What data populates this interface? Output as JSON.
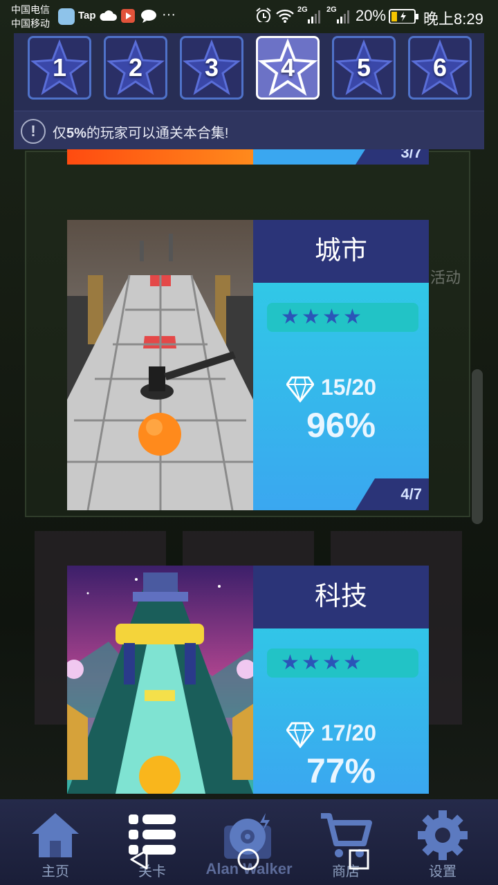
{
  "status_bar": {
    "carrier_1": "中国电信",
    "carrier_2": "中国移动",
    "tap_label": "Tap",
    "dots": "···",
    "signal_1": "2G",
    "signal_2": "2G",
    "battery": "20%",
    "time": "晚上8:29"
  },
  "level_tabs": [
    {
      "label": "1",
      "active": false
    },
    {
      "label": "2",
      "active": false
    },
    {
      "label": "3",
      "active": false
    },
    {
      "label": "4",
      "active": true
    },
    {
      "label": "5",
      "active": false
    },
    {
      "label": "6",
      "active": false
    }
  ],
  "notice": {
    "icon": "exclamation-icon",
    "prefix": "仅",
    "highlight": "5%",
    "suffix": "的玩家可以通关本合集!"
  },
  "background": {
    "event_text": "活动"
  },
  "cards": [
    {
      "title": "城市",
      "stars": 4,
      "diamonds": "15/20",
      "percent": "96%",
      "index": "4/7"
    },
    {
      "title": "科技",
      "stars": 4,
      "diamonds": "17/20",
      "percent": "77%"
    }
  ],
  "previous_card_index": "3/7",
  "bottom_nav": [
    {
      "label": "主页",
      "icon": "home-icon"
    },
    {
      "label": "关卡",
      "icon": "list-icon"
    },
    {
      "label": "Alan Walker",
      "icon": "music-disc-icon"
    },
    {
      "label": "商店",
      "icon": "cart-icon"
    },
    {
      "label": "设置",
      "icon": "gear-icon"
    }
  ],
  "colors": {
    "tab_border": "#4f72c9",
    "tab_active_fill": "#6c72c6",
    "card_header": "#2b3478",
    "card_info_top": "#2ed1e4",
    "card_info_bottom": "#3aa7f0",
    "star": "#2b55b8",
    "nav_bg": "#252a4a"
  }
}
